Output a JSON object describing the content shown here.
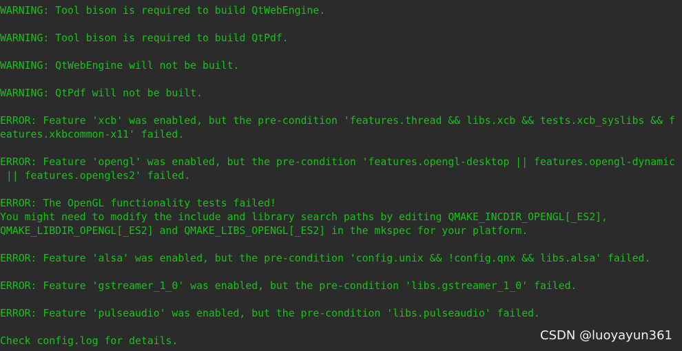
{
  "terminal": {
    "text_color": "#19c219",
    "background_color": "#2b2b2b",
    "lines": [
      "WARNING: Tool bison is required to build QtWebEngine.",
      "WARNING: Tool bison is required to build QtPdf.",
      "WARNING: QtWebEngine will not be built.",
      "WARNING: QtPdf will not be built.",
      "ERROR: Feature 'xcb' was enabled, but the pre-condition 'features.thread && libs.xcb && tests.xcb_syslibs && f",
      "eatures.xkbcommon-x11' failed.",
      "ERROR: Feature 'opengl' was enabled, but the pre-condition 'features.opengl-desktop || features.opengl-dynamic",
      " || features.opengles2' failed.",
      "ERROR: The OpenGL functionality tests failed!",
      "You might need to modify the include and library search paths by editing QMAKE_INCDIR_OPENGL[_ES2],",
      "QMAKE_LIBDIR_OPENGL[_ES2] and QMAKE_LIBS_OPENGL[_ES2] in the mkspec for your platform.",
      "ERROR: Feature 'alsa' was enabled, but the pre-condition 'config.unix && !config.qnx && libs.alsa' failed.",
      "ERROR: Feature 'gstreamer_1_0' was enabled, but the pre-condition 'libs.gstreamer_1_0' failed.",
      "ERROR: Feature 'pulseaudio' was enabled, but the pre-condition 'libs.pulseaudio' failed.",
      "Check config.log for details."
    ]
  },
  "watermark": {
    "text": "CSDN @luoyayun361"
  }
}
